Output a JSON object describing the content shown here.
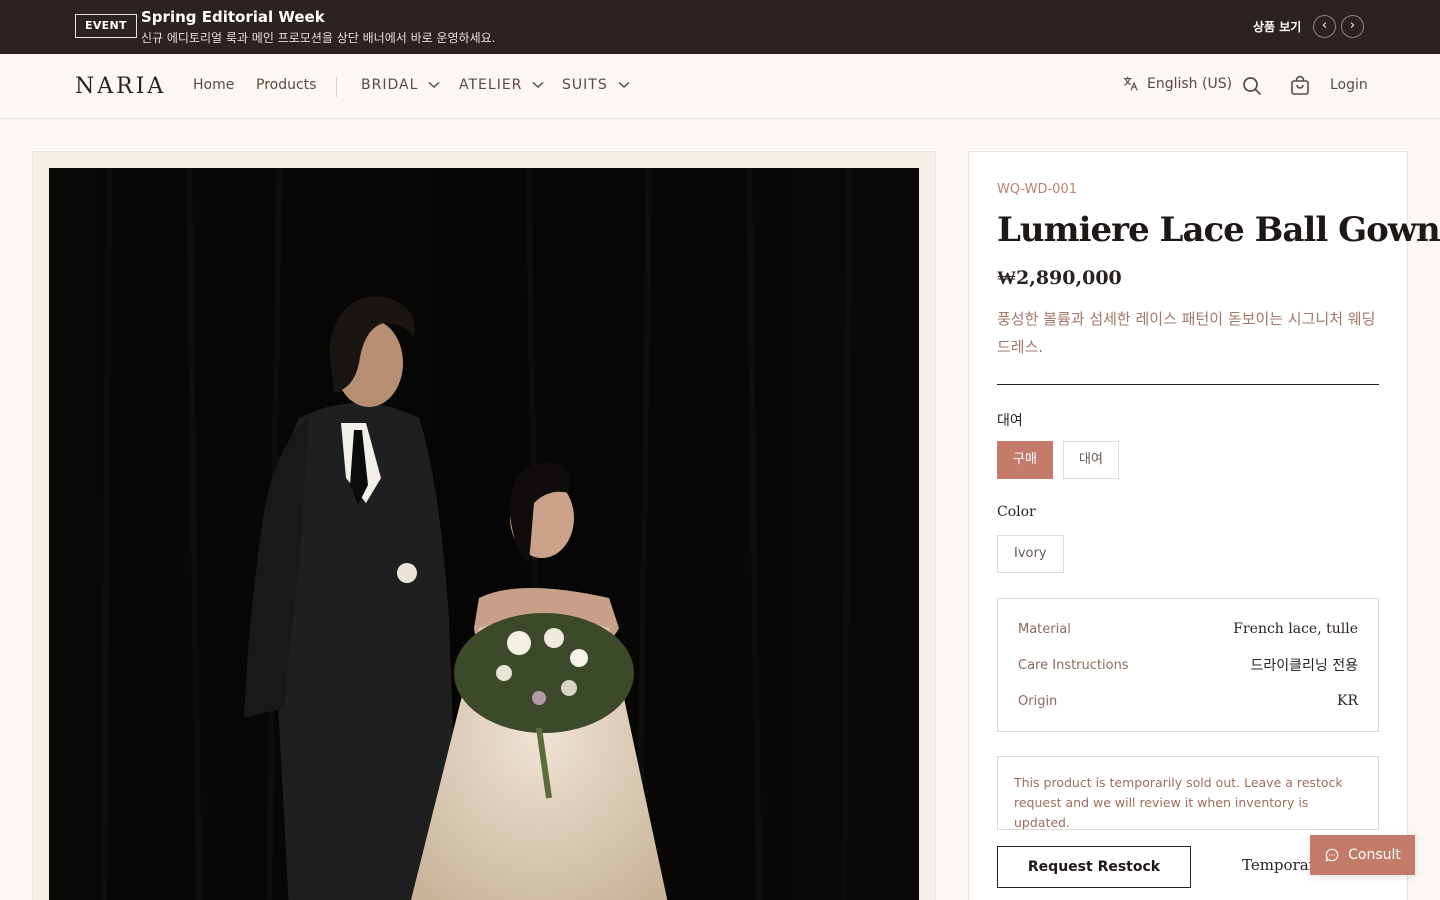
{
  "promo": {
    "badge": "EVENT",
    "title": "Spring Editorial Week",
    "subtitle": "신규 에디토리얼 룩과 메인 프로모션을 상단 배너에서 바로 운영하세요.",
    "view_label": "상품 보기",
    "prev_icon": "chevron-left-icon",
    "next_icon": "chevron-right-icon"
  },
  "nav": {
    "logo": "NARIA",
    "links": [
      "Home",
      "Products"
    ],
    "dropdowns": [
      "BRIDAL",
      "ATELIER",
      "SUITS"
    ],
    "language": "English (US)",
    "login": "Login",
    "icons": [
      "translate-icon",
      "search-icon",
      "cart-icon"
    ]
  },
  "product": {
    "sku": "WQ-WD-001",
    "name": "Lumiere Lace Ball Gown",
    "price": "₩2,890,000",
    "description": "풍성한 볼륨과 섬세한 레이스 패턴이 돋보이는 시그니처 웨딩드레스.",
    "purchase_type": {
      "label": "대여",
      "options": [
        "구매",
        "대여"
      ],
      "selected": "구매"
    },
    "color": {
      "label": "Color",
      "options": [
        "Ivory"
      ]
    },
    "specs": [
      {
        "key": "Material",
        "value": "French lace, tulle"
      },
      {
        "key": "Care Instructions",
        "value": "드라이클리닝 전용"
      },
      {
        "key": "Origin",
        "value": "KR"
      }
    ],
    "notice": "This product is temporarily sold out. Leave a restock request and we will review it when inventory is updated.",
    "restock_button": "Request Restock",
    "status_text": "Temporari"
  },
  "consult": {
    "label": "Consult",
    "icon": "chat-bubble-icon"
  },
  "colors": {
    "accent": "#c47c6a",
    "banner_bg": "#2a2320",
    "page_bg": "#fcf7f3"
  }
}
